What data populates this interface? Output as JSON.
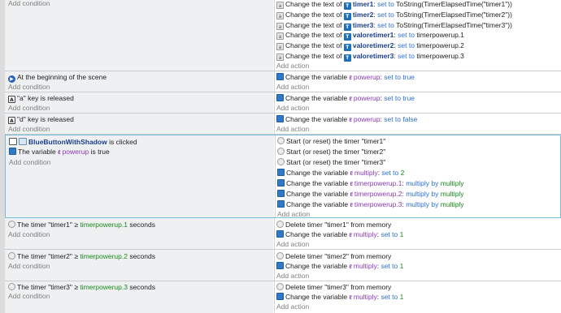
{
  "common": {
    "add_condition": "Add condition",
    "add_action": "Add action",
    "change_text_of": "Change the text of",
    "change_variable": "Change the variable",
    "set_to": "set to",
    "multiply_by": "multiply by",
    "start_reset_timer": "Start (or reset) the timer",
    "delete_timer": "Delete timer",
    "from_memory": "from memory",
    "the_timer": "The timer",
    "gte": "≥",
    "seconds": "seconds",
    "key_is_released": "key is released",
    "is_clicked": "is clicked",
    "the_variable": "The variable",
    "is_true": "is true"
  },
  "event1": {
    "actions": [
      {
        "object": "timer1",
        "expr": "ToString(TimerElapsedTime(\"timer1\"))"
      },
      {
        "object": "timer2",
        "expr": "ToString(TimerElapsedTime(\"timer2\"))"
      },
      {
        "object": "timer3",
        "expr": "ToString(TimerElapsedTime(\"timer3\"))"
      },
      {
        "object": "valoretimer1",
        "expr": "timerpowerup.1"
      },
      {
        "object": "valoretimer2",
        "expr": "timerpowerup.2"
      },
      {
        "object": "valoretimer3",
        "expr": "timerpowerup.3"
      }
    ]
  },
  "event2": {
    "condition": "At the beginning of the scene",
    "action": {
      "variable": "powerup",
      "value": "set to true"
    }
  },
  "event3": {
    "key": "\"a\"",
    "action": {
      "variable": "powerup",
      "value": "set to true"
    }
  },
  "event4": {
    "key": "\"d\"",
    "action": {
      "variable": "powerup",
      "value": "set to false"
    }
  },
  "event5": {
    "object": "BlueButtonWithShadow",
    "variable": "powerup",
    "timers": [
      "\"timer1\"",
      "\"timer2\"",
      "\"timer3\""
    ],
    "multiply_var": "multiply",
    "multiply_value": "2",
    "mult_targets": [
      "timerpowerup.1",
      "timerpowerup.2",
      "timerpowerup.3"
    ],
    "mult_source": "multiply"
  },
  "timer_events": [
    {
      "timer": "\"timer1\"",
      "limit": "timerpowerup.1",
      "variable": "multiply",
      "value": "1"
    },
    {
      "timer": "\"timer2\"",
      "limit": "timerpowerup.2",
      "variable": "multiply",
      "value": "1"
    },
    {
      "timer": "\"timer3\"",
      "limit": "timerpowerup.3",
      "variable": "multiply",
      "value": "1"
    }
  ],
  "icons": {
    "text": "text-object-icon",
    "variable": "scene-variable-icon",
    "timer": "timer-icon",
    "key": "keyboard-key-icon",
    "scene": "scene-start-icon",
    "object": "object-icon"
  }
}
